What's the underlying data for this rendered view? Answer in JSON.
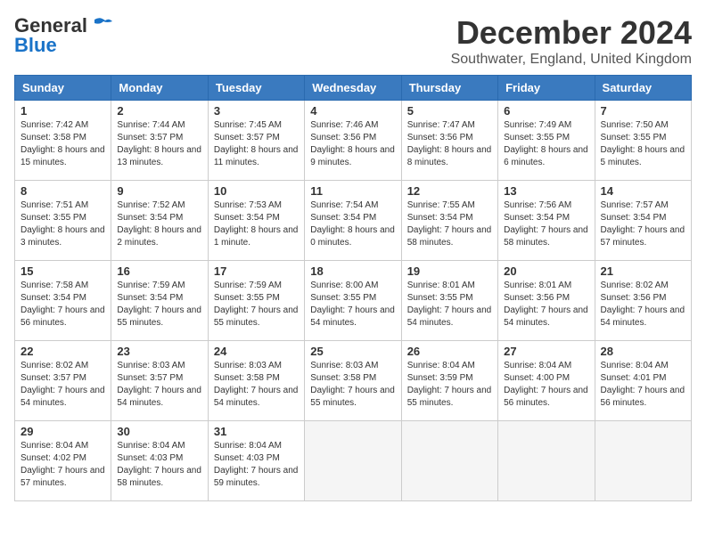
{
  "header": {
    "logo_general": "General",
    "logo_blue": "Blue",
    "month_title": "December 2024",
    "location": "Southwater, England, United Kingdom"
  },
  "weekdays": [
    "Sunday",
    "Monday",
    "Tuesday",
    "Wednesday",
    "Thursday",
    "Friday",
    "Saturday"
  ],
  "weeks": [
    [
      {
        "day": "1",
        "sunrise": "7:42 AM",
        "sunset": "3:58 PM",
        "daylight": "8 hours and 15 minutes."
      },
      {
        "day": "2",
        "sunrise": "7:44 AM",
        "sunset": "3:57 PM",
        "daylight": "8 hours and 13 minutes."
      },
      {
        "day": "3",
        "sunrise": "7:45 AM",
        "sunset": "3:57 PM",
        "daylight": "8 hours and 11 minutes."
      },
      {
        "day": "4",
        "sunrise": "7:46 AM",
        "sunset": "3:56 PM",
        "daylight": "8 hours and 9 minutes."
      },
      {
        "day": "5",
        "sunrise": "7:47 AM",
        "sunset": "3:56 PM",
        "daylight": "8 hours and 8 minutes."
      },
      {
        "day": "6",
        "sunrise": "7:49 AM",
        "sunset": "3:55 PM",
        "daylight": "8 hours and 6 minutes."
      },
      {
        "day": "7",
        "sunrise": "7:50 AM",
        "sunset": "3:55 PM",
        "daylight": "8 hours and 5 minutes."
      }
    ],
    [
      {
        "day": "8",
        "sunrise": "7:51 AM",
        "sunset": "3:55 PM",
        "daylight": "8 hours and 3 minutes."
      },
      {
        "day": "9",
        "sunrise": "7:52 AM",
        "sunset": "3:54 PM",
        "daylight": "8 hours and 2 minutes."
      },
      {
        "day": "10",
        "sunrise": "7:53 AM",
        "sunset": "3:54 PM",
        "daylight": "8 hours and 1 minute."
      },
      {
        "day": "11",
        "sunrise": "7:54 AM",
        "sunset": "3:54 PM",
        "daylight": "8 hours and 0 minutes."
      },
      {
        "day": "12",
        "sunrise": "7:55 AM",
        "sunset": "3:54 PM",
        "daylight": "7 hours and 58 minutes."
      },
      {
        "day": "13",
        "sunrise": "7:56 AM",
        "sunset": "3:54 PM",
        "daylight": "7 hours and 58 minutes."
      },
      {
        "day": "14",
        "sunrise": "7:57 AM",
        "sunset": "3:54 PM",
        "daylight": "7 hours and 57 minutes."
      }
    ],
    [
      {
        "day": "15",
        "sunrise": "7:58 AM",
        "sunset": "3:54 PM",
        "daylight": "7 hours and 56 minutes."
      },
      {
        "day": "16",
        "sunrise": "7:59 AM",
        "sunset": "3:54 PM",
        "daylight": "7 hours and 55 minutes."
      },
      {
        "day": "17",
        "sunrise": "7:59 AM",
        "sunset": "3:55 PM",
        "daylight": "7 hours and 55 minutes."
      },
      {
        "day": "18",
        "sunrise": "8:00 AM",
        "sunset": "3:55 PM",
        "daylight": "7 hours and 54 minutes."
      },
      {
        "day": "19",
        "sunrise": "8:01 AM",
        "sunset": "3:55 PM",
        "daylight": "7 hours and 54 minutes."
      },
      {
        "day": "20",
        "sunrise": "8:01 AM",
        "sunset": "3:56 PM",
        "daylight": "7 hours and 54 minutes."
      },
      {
        "day": "21",
        "sunrise": "8:02 AM",
        "sunset": "3:56 PM",
        "daylight": "7 hours and 54 minutes."
      }
    ],
    [
      {
        "day": "22",
        "sunrise": "8:02 AM",
        "sunset": "3:57 PM",
        "daylight": "7 hours and 54 minutes."
      },
      {
        "day": "23",
        "sunrise": "8:03 AM",
        "sunset": "3:57 PM",
        "daylight": "7 hours and 54 minutes."
      },
      {
        "day": "24",
        "sunrise": "8:03 AM",
        "sunset": "3:58 PM",
        "daylight": "7 hours and 54 minutes."
      },
      {
        "day": "25",
        "sunrise": "8:03 AM",
        "sunset": "3:58 PM",
        "daylight": "7 hours and 55 minutes."
      },
      {
        "day": "26",
        "sunrise": "8:04 AM",
        "sunset": "3:59 PM",
        "daylight": "7 hours and 55 minutes."
      },
      {
        "day": "27",
        "sunrise": "8:04 AM",
        "sunset": "4:00 PM",
        "daylight": "7 hours and 56 minutes."
      },
      {
        "day": "28",
        "sunrise": "8:04 AM",
        "sunset": "4:01 PM",
        "daylight": "7 hours and 56 minutes."
      }
    ],
    [
      {
        "day": "29",
        "sunrise": "8:04 AM",
        "sunset": "4:02 PM",
        "daylight": "7 hours and 57 minutes."
      },
      {
        "day": "30",
        "sunrise": "8:04 AM",
        "sunset": "4:03 PM",
        "daylight": "7 hours and 58 minutes."
      },
      {
        "day": "31",
        "sunrise": "8:04 AM",
        "sunset": "4:03 PM",
        "daylight": "7 hours and 59 minutes."
      },
      null,
      null,
      null,
      null
    ]
  ]
}
